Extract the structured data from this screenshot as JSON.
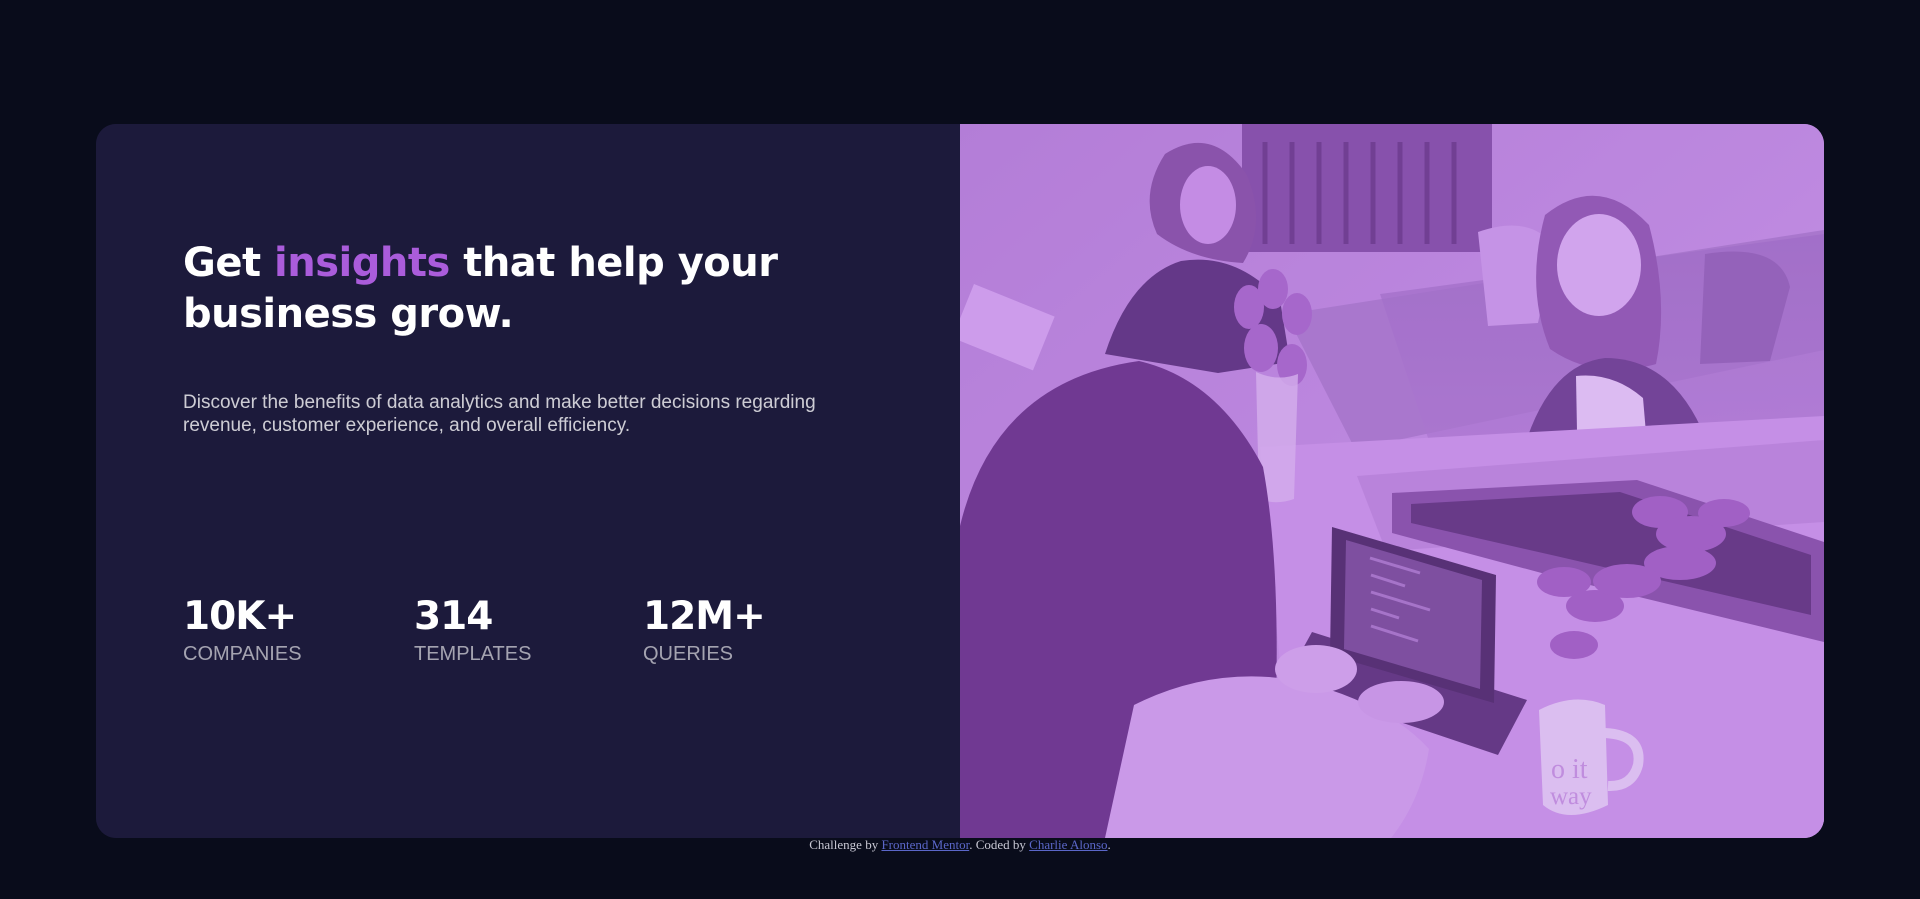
{
  "hero": {
    "headline_before": "Get ",
    "headline_accent": "insights",
    "headline_after": " that help your business grow.",
    "description": "Discover the benefits of data analytics and make better decisions regarding revenue, customer experience, and overall efficiency."
  },
  "stats": [
    {
      "value": "10K+",
      "label": "companies"
    },
    {
      "value": "314",
      "label": "templates"
    },
    {
      "value": "12M+",
      "label": "queries"
    }
  ],
  "mug_text": {
    "line1": "o it",
    "line2": "way"
  },
  "attribution": {
    "prefix": "Challenge by ",
    "frontend_mentor": "Frontend Mentor",
    "middle": ". Coded by ",
    "author": "Charlie Alonso",
    "suffix": "."
  },
  "colors": {
    "page_background": "#090c1b",
    "card_background": "#1c1a3b",
    "accent": "#aa5cdb",
    "image_tint": "#c99be6",
    "link": "#5b67c9"
  }
}
